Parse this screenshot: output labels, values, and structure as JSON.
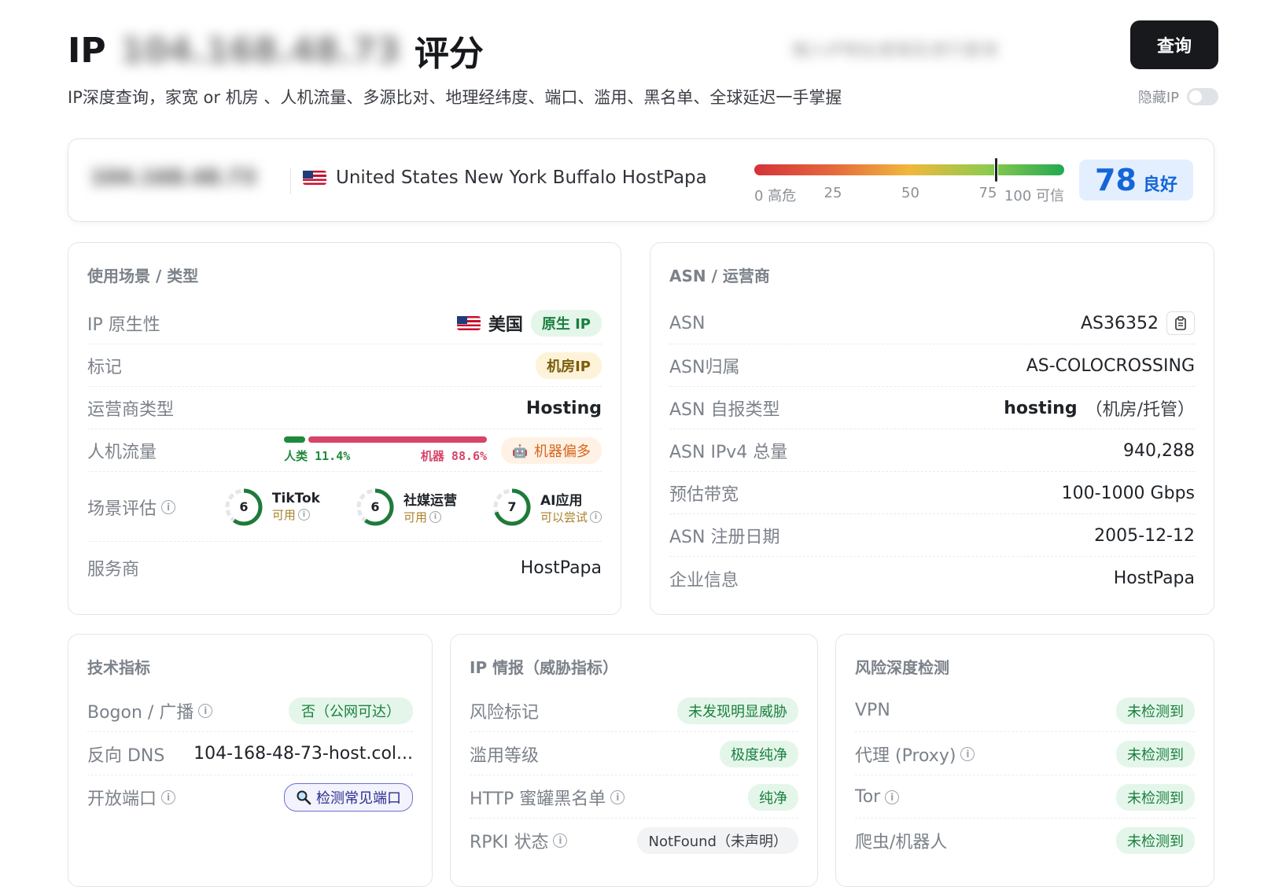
{
  "header": {
    "title_prefix": "IP",
    "title_ip": "104.168.48.73",
    "title_suffix": "评分",
    "search_placeholder": "输入IP地址或域名进行查询",
    "query_button": "查询",
    "subtitle": "IP深度查询，家宽 or 机房 、人机流量、多源比对、地理经纬度、端口、滥用、黑名单、全球延迟一手掌握",
    "hide_ip_label": "隐藏IP",
    "hide_ip_enabled": false
  },
  "score": {
    "ip": "104.168.48.73",
    "location": "United States New York Buffalo HostPapa",
    "value": "78",
    "rating": "良好",
    "ticks": [
      "0 高危",
      "25",
      "50",
      "75",
      "100 可信"
    ],
    "colors": {
      "badge_bg": "#e3efff",
      "badge_text": "#1565d8"
    }
  },
  "usage": {
    "title": "使用场景 / 类型",
    "native_label": "IP 原生性",
    "native_country": "美国",
    "native_badge": "原生 IP",
    "tag_label": "标记",
    "tag_value": "机房IP",
    "isp_type_label": "运营商类型",
    "isp_type_value": "Hosting",
    "traffic_label": "人机流量",
    "traffic_human_label": "人类",
    "traffic_human_pct": "11.4%",
    "traffic_human_fraction": 0.114,
    "traffic_bot_label": "机器",
    "traffic_bot_pct": "88.6%",
    "traffic_badge": "机器偏多",
    "scene_label": "场景评估",
    "scenes": [
      {
        "score": "6",
        "score_fraction": 0.6,
        "name": "TikTok",
        "status": "可用"
      },
      {
        "score": "6",
        "score_fraction": 0.6,
        "name": "社媒运营",
        "status": "可用"
      },
      {
        "score": "7",
        "score_fraction": 0.7,
        "name": "AI应用",
        "status": "可以尝试"
      }
    ],
    "provider_label": "服务商",
    "provider_value": "HostPapa"
  },
  "asn": {
    "title": "ASN / 运营商",
    "asn_label": "ASN",
    "asn_value": "AS36352",
    "owner_label": "ASN归属",
    "owner_value": "AS-COLOCROSSING",
    "type_label": "ASN 自报类型",
    "type_value": "hosting",
    "type_note": "（机房/托管）",
    "ipv4_label": "ASN IPv4 总量",
    "ipv4_value": "940,288",
    "bandwidth_label": "预估带宽",
    "bandwidth_value": "100-1000 Gbps",
    "reg_label": "ASN 注册日期",
    "reg_value": "2005-12-12",
    "company_label": "企业信息",
    "company_value": "HostPapa"
  },
  "tech": {
    "title": "技术指标",
    "bogon_label": "Bogon / 广播",
    "bogon_value": "否（公网可达）",
    "rdns_label": "反向 DNS",
    "rdns_value": "104-168-48-73-host.col...",
    "ports_label": "开放端口",
    "ports_button": "检测常见端口"
  },
  "threat": {
    "title": "IP 情报（威胁指标）",
    "risk_label": "风险标记",
    "risk_value": "未发现明显威胁",
    "abuse_label": "滥用等级",
    "abuse_value": "极度纯净",
    "honeypot_label": "HTTP 蜜罐黑名单",
    "honeypot_value": "纯净",
    "rpki_label": "RPKI 状态",
    "rpki_value": "NotFound（未声明）"
  },
  "risk": {
    "title": "风险深度检测",
    "items": [
      {
        "label": "VPN",
        "value": "未检测到"
      },
      {
        "label": "代理 (Proxy)",
        "value": "未检测到"
      },
      {
        "label": "Tor",
        "value": "未检测到"
      },
      {
        "label": "爬虫/机器人",
        "value": "未检测到"
      }
    ]
  }
}
